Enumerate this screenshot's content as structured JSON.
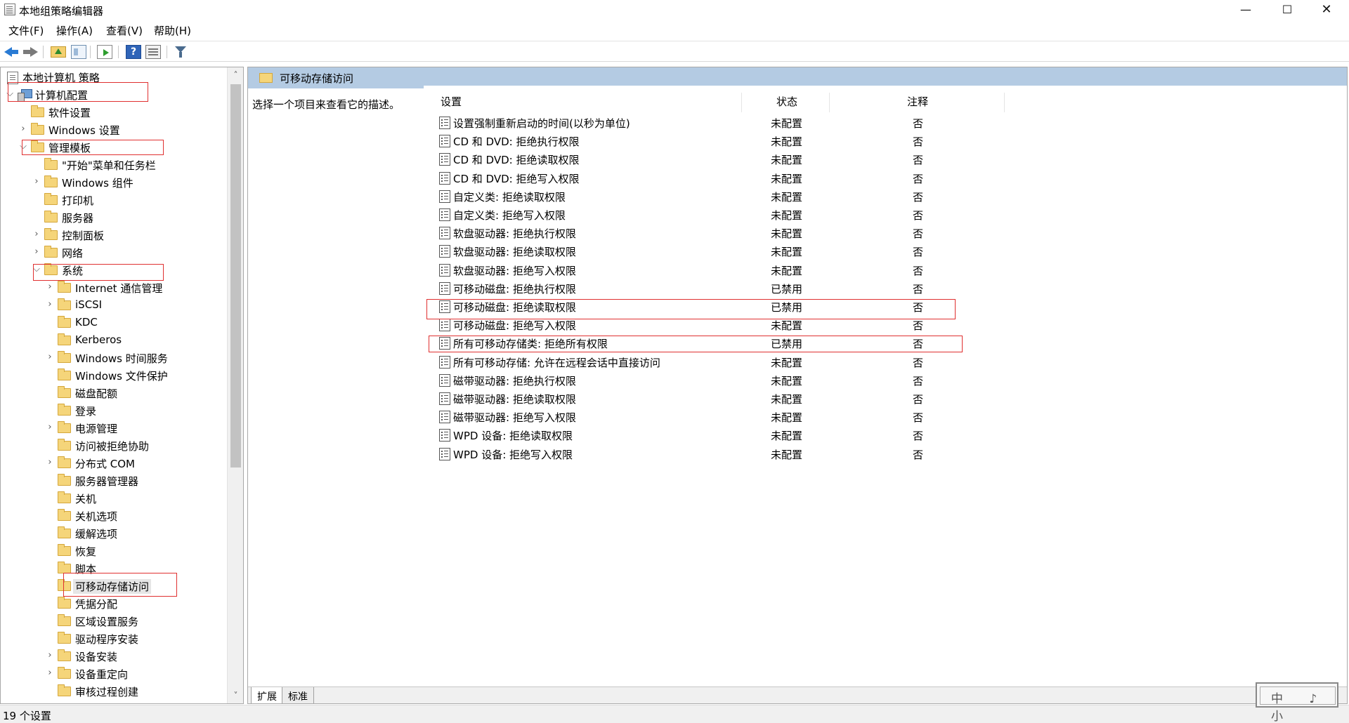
{
  "window": {
    "title": "本地组策略编辑器",
    "minimize": "—",
    "maximize": "☐",
    "close": "✕"
  },
  "menu": [
    "文件(F)",
    "操作(A)",
    "查看(V)",
    "帮助(H)"
  ],
  "toolbar_icons": [
    "back-icon",
    "forward-icon",
    "up-folder-icon",
    "show-hide-tree-icon",
    "export-list-icon",
    "help-icon",
    "properties-icon",
    "filter-icon"
  ],
  "tree": {
    "root": "本地计算机 策略",
    "items": [
      {
        "label": "计算机配置",
        "chevron": "⌵"
      },
      {
        "label": "软件设置",
        "chevron": ""
      },
      {
        "label": "Windows 设置",
        "chevron": "›"
      },
      {
        "label": "管理模板",
        "chevron": "⌵"
      },
      {
        "label": "\"开始\"菜单和任务栏",
        "chevron": ""
      },
      {
        "label": "Windows 组件",
        "chevron": "›"
      },
      {
        "label": "打印机",
        "chevron": ""
      },
      {
        "label": "服务器",
        "chevron": ""
      },
      {
        "label": "控制面板",
        "chevron": "›"
      },
      {
        "label": "网络",
        "chevron": "›"
      },
      {
        "label": "系统",
        "chevron": "⌵"
      },
      {
        "label": "Internet 通信管理",
        "chevron": "›"
      },
      {
        "label": "iSCSI",
        "chevron": "›"
      },
      {
        "label": "KDC",
        "chevron": ""
      },
      {
        "label": "Kerberos",
        "chevron": ""
      },
      {
        "label": "Windows 时间服务",
        "chevron": "›"
      },
      {
        "label": "Windows 文件保护",
        "chevron": ""
      },
      {
        "label": "磁盘配额",
        "chevron": ""
      },
      {
        "label": "登录",
        "chevron": ""
      },
      {
        "label": "电源管理",
        "chevron": "›"
      },
      {
        "label": "访问被拒绝协助",
        "chevron": ""
      },
      {
        "label": "分布式 COM",
        "chevron": "›"
      },
      {
        "label": "服务器管理器",
        "chevron": ""
      },
      {
        "label": "关机",
        "chevron": ""
      },
      {
        "label": "关机选项",
        "chevron": ""
      },
      {
        "label": "缓解选项",
        "chevron": ""
      },
      {
        "label": "恢复",
        "chevron": ""
      },
      {
        "label": "脚本",
        "chevron": ""
      },
      {
        "label": "可移动存储访问",
        "chevron": ""
      },
      {
        "label": "凭据分配",
        "chevron": ""
      },
      {
        "label": "区域设置服务",
        "chevron": ""
      },
      {
        "label": "驱动程序安装",
        "chevron": ""
      },
      {
        "label": "设备安装",
        "chevron": "›"
      },
      {
        "label": "设备重定向",
        "chevron": "›"
      },
      {
        "label": "审核过程创建",
        "chevron": ""
      }
    ],
    "scroll_up": "˄",
    "scroll_down": "˅"
  },
  "content": {
    "header_title": "可移动存储访问",
    "description": "选择一个项目来查看它的描述。",
    "columns": {
      "setting": "设置",
      "state": "状态",
      "note": "注释"
    },
    "rows": [
      {
        "name": "设置强制重新启动的时间(以秒为单位)",
        "state": "未配置",
        "note": "否"
      },
      {
        "name": "CD 和 DVD: 拒绝执行权限",
        "state": "未配置",
        "note": "否"
      },
      {
        "name": "CD 和 DVD: 拒绝读取权限",
        "state": "未配置",
        "note": "否"
      },
      {
        "name": "CD 和 DVD: 拒绝写入权限",
        "state": "未配置",
        "note": "否"
      },
      {
        "name": "自定义类: 拒绝读取权限",
        "state": "未配置",
        "note": "否"
      },
      {
        "name": "自定义类: 拒绝写入权限",
        "state": "未配置",
        "note": "否"
      },
      {
        "name": "软盘驱动器: 拒绝执行权限",
        "state": "未配置",
        "note": "否"
      },
      {
        "name": "软盘驱动器: 拒绝读取权限",
        "state": "未配置",
        "note": "否"
      },
      {
        "name": "软盘驱动器: 拒绝写入权限",
        "state": "未配置",
        "note": "否"
      },
      {
        "name": "可移动磁盘: 拒绝执行权限",
        "state": "已禁用",
        "note": "否"
      },
      {
        "name": "可移动磁盘: 拒绝读取权限",
        "state": "已禁用",
        "note": "否"
      },
      {
        "name": "可移动磁盘: 拒绝写入权限",
        "state": "未配置",
        "note": "否"
      },
      {
        "name": "所有可移动存储类: 拒绝所有权限",
        "state": "已禁用",
        "note": "否"
      },
      {
        "name": "所有可移动存储: 允许在远程会话中直接访问",
        "state": "未配置",
        "note": "否"
      },
      {
        "name": "磁带驱动器: 拒绝执行权限",
        "state": "未配置",
        "note": "否"
      },
      {
        "name": "磁带驱动器: 拒绝读取权限",
        "state": "未配置",
        "note": "否"
      },
      {
        "name": "磁带驱动器: 拒绝写入权限",
        "state": "未配置",
        "note": "否"
      },
      {
        "name": "WPD 设备: 拒绝读取权限",
        "state": "未配置",
        "note": "否"
      },
      {
        "name": "WPD 设备: 拒绝写入权限",
        "state": "未配置",
        "note": "否"
      }
    ],
    "tabs": [
      "扩展",
      "标准"
    ]
  },
  "status": "19 个设置",
  "watermark": "中 ♪ 小"
}
